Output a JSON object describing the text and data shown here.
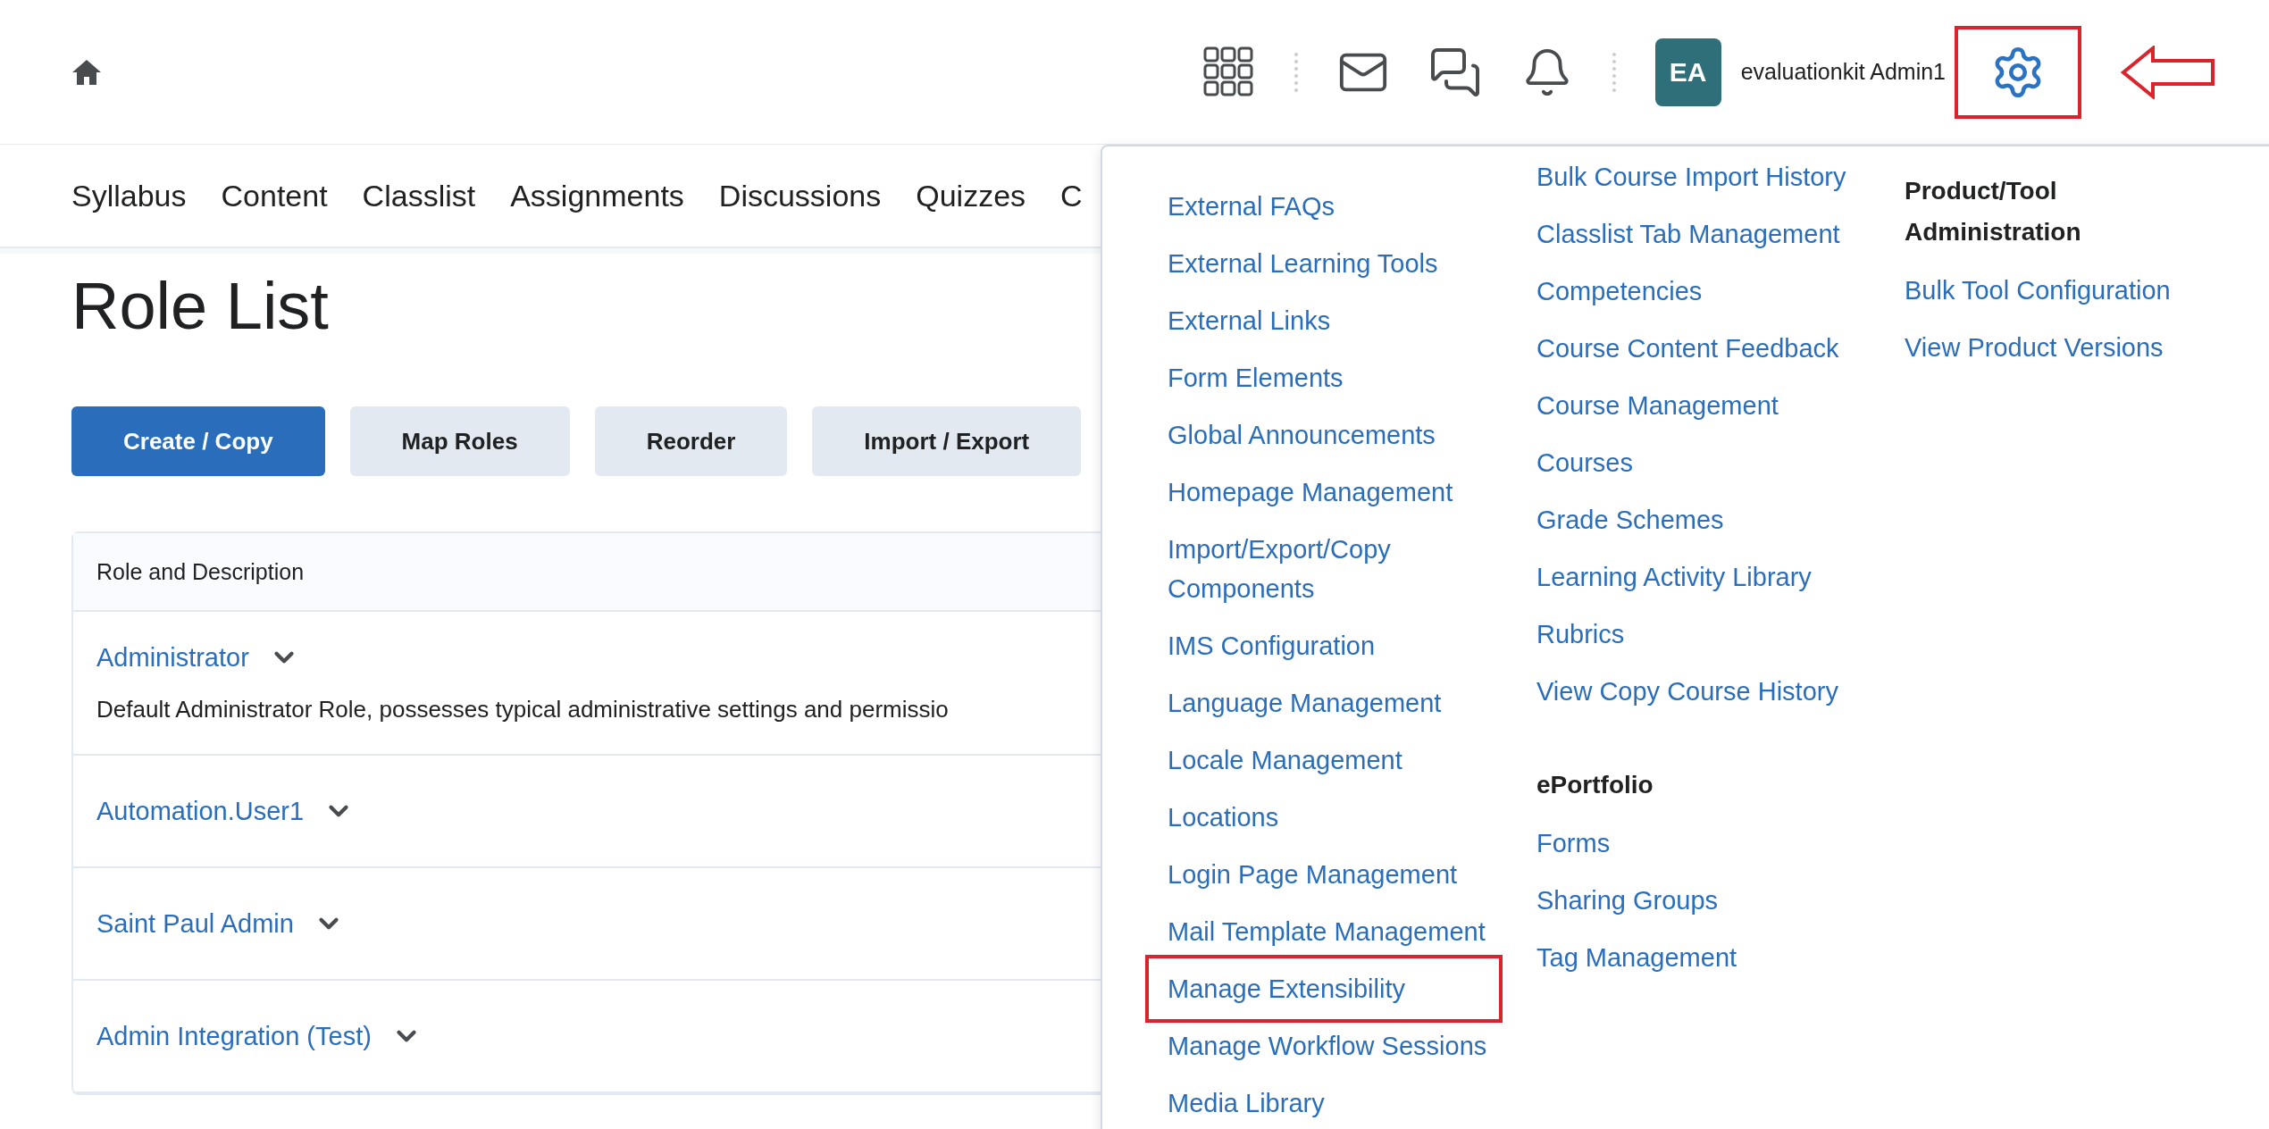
{
  "header": {
    "user": {
      "initials": "EA",
      "name": "evaluationkit Admin1"
    },
    "settings": {
      "highlighted": true,
      "pointer_arrow": true
    }
  },
  "nav": [
    "Syllabus",
    "Content",
    "Classlist",
    "Assignments",
    "Discussions",
    "Quizzes",
    "C"
  ],
  "page_title": "Role List",
  "actions": [
    {
      "label": "Create / Copy",
      "primary": true
    },
    {
      "label": "Map Roles",
      "primary": false
    },
    {
      "label": "Reorder",
      "primary": false
    },
    {
      "label": "Import / Export",
      "primary": false
    }
  ],
  "table": {
    "columns": [
      "Role and Description"
    ],
    "rows": [
      {
        "role": "Administrator",
        "description": "Default Administrator Role, possesses typical administrative settings and permissio"
      },
      {
        "role": "Automation.User1"
      },
      {
        "role": "Saint Paul Admin"
      },
      {
        "role": "Admin Integration (Test)"
      }
    ]
  },
  "admin_menu": {
    "columns": [
      {
        "groups": [
          {
            "items": [
              {
                "label": "External FAQs",
                "highlighted": false
              },
              {
                "label": "External Learning Tools",
                "highlighted": false
              },
              {
                "label": "External Links",
                "highlighted": false
              },
              {
                "label": "Form Elements",
                "highlighted": false
              },
              {
                "label": "Global Announcements",
                "highlighted": false
              },
              {
                "label": "Homepage Management",
                "highlighted": false
              },
              {
                "label": "Import/Export/Copy Components",
                "highlighted": false
              },
              {
                "label": "IMS Configuration",
                "highlighted": false
              },
              {
                "label": "Language Management",
                "highlighted": false
              },
              {
                "label": "Locale Management",
                "highlighted": false
              },
              {
                "label": "Locations",
                "highlighted": false
              },
              {
                "label": "Login Page Management",
                "highlighted": false
              },
              {
                "label": "Mail Template Management",
                "highlighted": false
              },
              {
                "label": "Manage Extensibility",
                "highlighted": true
              },
              {
                "label": "Manage Workflow Sessions",
                "highlighted": false
              },
              {
                "label": "Media Library",
                "highlighted": false
              }
            ]
          }
        ]
      },
      {
        "groups": [
          {
            "items": [
              {
                "label": "Bulk Course Import History",
                "highlighted": false
              },
              {
                "label": "Classlist Tab Management",
                "highlighted": false
              },
              {
                "label": "Competencies",
                "highlighted": false
              },
              {
                "label": "Course Content Feedback",
                "highlighted": false
              },
              {
                "label": "Course Management",
                "highlighted": false
              },
              {
                "label": "Courses",
                "highlighted": false
              },
              {
                "label": "Grade Schemes",
                "highlighted": false
              },
              {
                "label": "Learning Activity Library",
                "highlighted": false
              },
              {
                "label": "Rubrics",
                "highlighted": false
              },
              {
                "label": "View Copy Course History",
                "highlighted": false
              }
            ]
          },
          {
            "heading": "ePortfolio",
            "items": [
              {
                "label": "Forms",
                "highlighted": false
              },
              {
                "label": "Sharing Groups",
                "highlighted": false
              },
              {
                "label": "Tag Management",
                "highlighted": false
              }
            ]
          }
        ]
      },
      {
        "groups": [
          {
            "heading": "Product/Tool Administration",
            "items": [
              {
                "label": "Bulk Tool Configuration",
                "highlighted": false
              },
              {
                "label": "View Product Versions",
                "highlighted": false
              }
            ]
          }
        ]
      }
    ]
  }
}
